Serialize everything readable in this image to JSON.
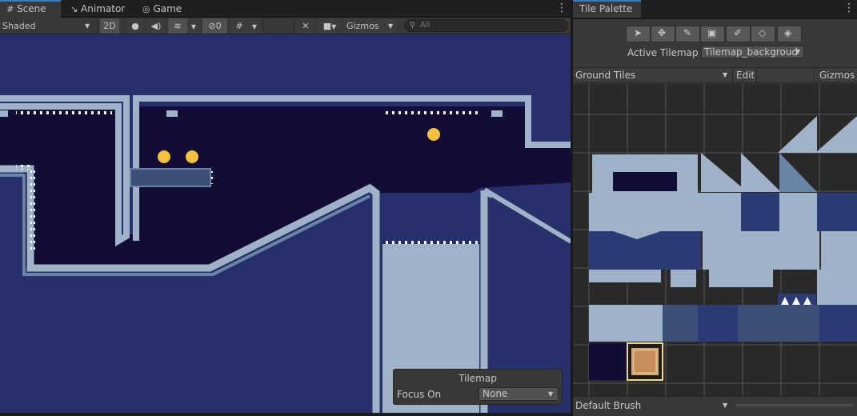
{
  "scene_tabs": [
    {
      "label": "Scene",
      "icon": "grid-icon",
      "active": true
    },
    {
      "label": "Animator",
      "icon": "animator-icon",
      "active": false
    },
    {
      "label": "Game",
      "icon": "gamepad-icon",
      "active": false
    }
  ],
  "scene_toolbar": {
    "shading_mode": "Shaded",
    "mode_2d": "2D",
    "hidden_count": "0",
    "gizmos_label": "Gizmos",
    "search_placeholder": "All"
  },
  "tilemap_overlay": {
    "title": "Tilemap",
    "focus_label": "Focus On",
    "focus_value": "None"
  },
  "palette": {
    "tab_title": "Tile Palette",
    "tools": [
      "select-tool-icon",
      "move-tool-icon",
      "paint-brush-icon",
      "box-fill-icon",
      "picker-icon",
      "eraser-icon",
      "fill-bucket-icon"
    ],
    "active_tilemap_label": "Active Tilemap",
    "active_tilemap_value": "Tilemap_backgroud",
    "palette_name": "Ground Tiles",
    "edit_label": "Edit",
    "gizmos_label": "Gizmos",
    "brush_label": "Default Brush"
  },
  "colors": {
    "accent": "#3a79bb",
    "scene_bg": "#27306a",
    "cave_dark": "#120d36",
    "wall_light": "#9fb2c8",
    "wall_mid": "#6a84a8",
    "coin": "#f5c13c"
  }
}
